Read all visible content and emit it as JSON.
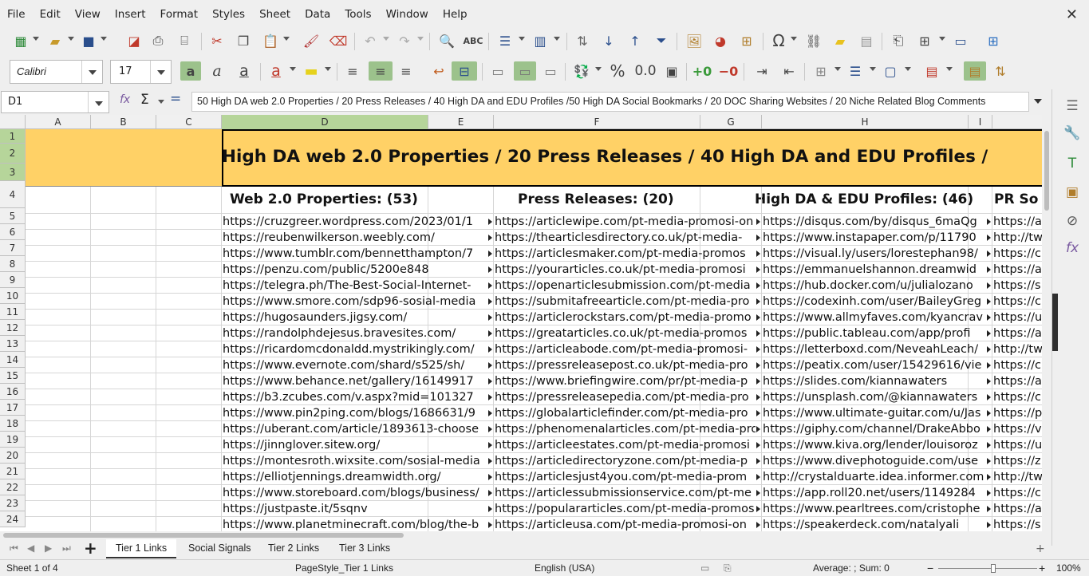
{
  "menu": [
    "File",
    "Edit",
    "View",
    "Insert",
    "Format",
    "Styles",
    "Sheet",
    "Data",
    "Tools",
    "Window",
    "Help"
  ],
  "font": {
    "name": "Calibri",
    "size": "17"
  },
  "namebox": "D1",
  "formula": "50 High DA web 2.0 Properties / 20 Press Releases / 40 High DA and EDU Profiles /50 High DA Social Bookmarks / 20 DOC Sharing Websites / 20 Niche Related Blog Comments",
  "columns": [
    "A",
    "B",
    "C",
    "D",
    "E",
    "F",
    "G",
    "H",
    "I"
  ],
  "rows": [
    "1",
    "2",
    "3",
    "4",
    "5",
    "6",
    "7",
    "8",
    "9",
    "10",
    "11",
    "12",
    "13",
    "14",
    "15",
    "16",
    "17",
    "18",
    "19",
    "20",
    "21",
    "22",
    "23",
    "24"
  ],
  "banner": "High DA web 2.0 Properties / 20 Press Releases / 40 High DA and EDU Profiles /",
  "headers": {
    "web20": "Web 2.0 Properties: (53)",
    "press": "Press Releases: (20)",
    "edu": "High DA & EDU Profiles: (46)",
    "pr": "PR So"
  },
  "data": [
    [
      "https://cruzgreer.wordpress.com/2023/01/1",
      "https://articlewipe.com/pt-media-promosi-on",
      "https://disqus.com/by/disqus_6maQg",
      "https://a"
    ],
    [
      "https://reubenwilkerson.weebly.com/",
      "https://thearticlesdirectory.co.uk/pt-media-",
      "https://www.instapaper.com/p/11790",
      "http://tw"
    ],
    [
      "https://www.tumblr.com/bennetthampton/7",
      "https://articlesmaker.com/pt-media-promos",
      "https://visual.ly/users/lorestephan98/",
      "https://c"
    ],
    [
      "https://penzu.com/public/5200e848",
      "https://yourarticles.co.uk/pt-media-promosi",
      "https://emmanuelshannon.dreamwid",
      "https://a"
    ],
    [
      "https://telegra.ph/The-Best-Social-Internet-",
      "https://openarticlesubmission.com/pt-media",
      "https://hub.docker.com/u/julialozano",
      "https://s"
    ],
    [
      "https://www.smore.com/sdp96-sosial-media",
      "https://submitafreearticle.com/pt-media-pro",
      "https://codexinh.com/user/BaileyGreg",
      "https://c"
    ],
    [
      "https://hugosaunders.jigsy.com/",
      "https://articlerockstars.com/pt-media-promo",
      "https://www.allmyfaves.com/kyancrav",
      "https://u"
    ],
    [
      "https://randolphdejesus.bravesites.com/",
      "https://greatarticles.co.uk/pt-media-promos",
      "https://public.tableau.com/app/profi",
      "https://a"
    ],
    [
      "https://ricardomcdonaldd.mystrikingly.com/",
      "https://articleabode.com/pt-media-promosi-",
      "https://letterboxd.com/NeveahLeach/",
      "http://tw"
    ],
    [
      "https://www.evernote.com/shard/s525/sh/",
      "https://pressreleasepost.co.uk/pt-media-pro",
      "https://peatix.com/user/15429616/vie",
      "https://c"
    ],
    [
      "https://www.behance.net/gallery/16149917",
      "https://www.briefingwire.com/pr/pt-media-p",
      "https://slides.com/kiannawaters",
      "https://a"
    ],
    [
      "https://b3.zcubes.com/v.aspx?mid=101327",
      "https://pressreleasepedia.com/pt-media-pro",
      "https://unsplash.com/@kiannawaters",
      "https://c"
    ],
    [
      "https://www.pin2ping.com/blogs/1686631/9",
      "https://globalarticlefinder.com/pt-media-pro",
      "https://www.ultimate-guitar.com/u/Jas",
      "https://p"
    ],
    [
      "https://uberant.com/article/1893613-choose",
      "https://phenomenalarticles.com/pt-media-pro",
      "https://giphy.com/channel/DrakeAbbo",
      "https://v"
    ],
    [
      "https://jinnglover.sitew.org/",
      "https://articleestates.com/pt-media-promosi",
      "https://www.kiva.org/lender/louisoroz",
      "https://u"
    ],
    [
      "https://montesroth.wixsite.com/sosial-media",
      "https://articledirectoryzone.com/pt-media-p",
      "https://www.divephotoguide.com/use",
      "https://z"
    ],
    [
      "https://elliotjennings.dreamwidth.org/",
      "https://articlesjust4you.com/pt-media-prom",
      "http://crystalduarte.idea.informer.com",
      "http://tw"
    ],
    [
      "https://www.storeboard.com/blogs/business/",
      "https://articlessubmissionservice.com/pt-me",
      "https://app.roll20.net/users/1149284",
      "https://c"
    ],
    [
      "https://justpaste.it/5sqnv",
      "https://populararticles.com/pt-media-promosi",
      "https://www.pearltrees.com/cristophe",
      "https://a"
    ],
    [
      "https://www.planetminecraft.com/blog/the-b",
      "https://articleusa.com/pt-media-promosi-on",
      "https://speakerdeck.com/natalyali",
      "https://s"
    ]
  ],
  "tabs": [
    "Tier 1 Links",
    "Social Signals",
    "Tier 2 Links",
    "Tier 3 Links"
  ],
  "status": {
    "sheet": "Sheet 1 of 4",
    "style": "PageStyle_Tier 1 Links",
    "lang": "English (USA)",
    "sum": "Average: ; Sum: 0",
    "zoom": "100%"
  },
  "colors": {
    "banner": "#ffd166",
    "selection": "#b6d59a"
  },
  "icons": [
    "new-icon",
    "open-icon",
    "save-icon",
    "export-pdf-icon",
    "print-icon",
    "print-preview-icon",
    "cut-icon",
    "copy-icon",
    "paste-icon",
    "clone-formatting-icon",
    "clear-formatting-icon",
    "undo-icon",
    "redo-icon",
    "find-replace-icon",
    "spellcheck-icon",
    "row-icon",
    "column-icon",
    "sort-icon",
    "sort-ascending-icon",
    "sort-descending-icon",
    "autofilter-icon",
    "image-icon",
    "chart-icon",
    "pivot-table-icon",
    "special-character-icon",
    "hyperlink-icon",
    "comment-icon",
    "header-footer-icon",
    "define-print-area-icon",
    "freeze-icon",
    "split-window-icon",
    "show-draw-functions-icon"
  ]
}
